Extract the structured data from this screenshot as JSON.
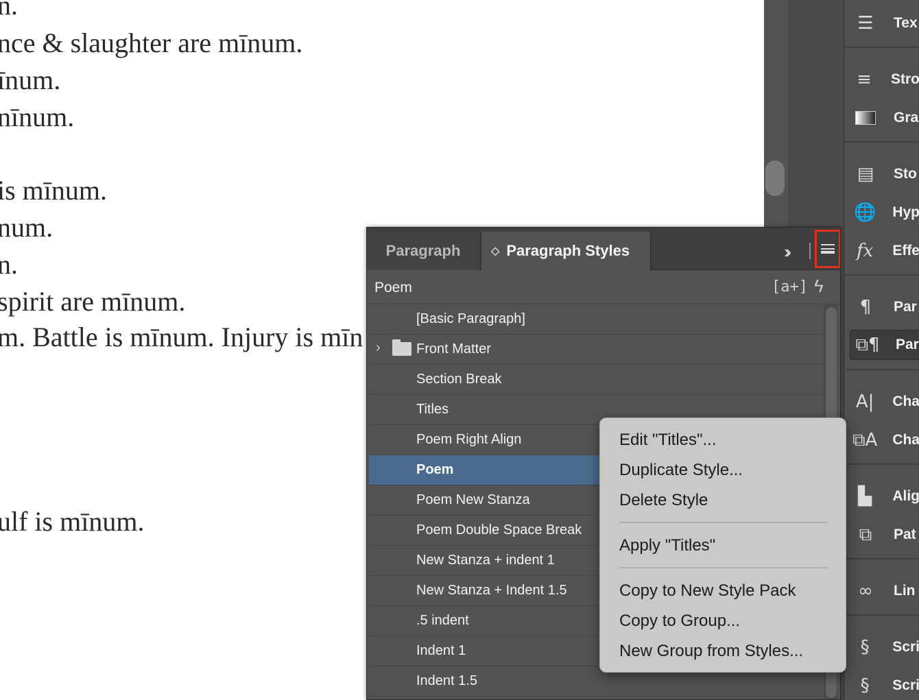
{
  "document": {
    "lines": [
      "n.",
      "nce & slaughter are mīnum.",
      "īnum.",
      "nīnum.",
      " is mīnum.",
      "num.",
      "n.",
      "spirit are mīnum.",
      "m. Battle is mīnum. Injury is mīn",
      "ulf is mīnum."
    ]
  },
  "dock": {
    "items": [
      {
        "icon": "text-wrap-icon",
        "label": "Tex"
      },
      {
        "icon": "stroke-icon",
        "label": "Stro"
      },
      {
        "icon": "gradient-icon",
        "label": "Gra"
      },
      {
        "icon": "story-icon",
        "label": "Sto"
      },
      {
        "icon": "hyperlinks-icon",
        "label": "Hyp"
      },
      {
        "icon": "effects-icon",
        "label": "Effe"
      },
      {
        "icon": "paragraph-icon",
        "label": "Par"
      },
      {
        "icon": "paragraph-styles-icon",
        "label": "Par"
      },
      {
        "icon": "character-icon",
        "label": "Cha"
      },
      {
        "icon": "character-styles-icon",
        "label": "Cha"
      },
      {
        "icon": "align-icon",
        "label": "Alig"
      },
      {
        "icon": "pathfinder-icon",
        "label": "Pat"
      },
      {
        "icon": "links-icon",
        "label": "Lin"
      },
      {
        "icon": "scripts-icon",
        "label": "Scri"
      },
      {
        "icon": "script-label-icon",
        "label": "Scri"
      }
    ]
  },
  "panel": {
    "tabs": [
      {
        "label": "Paragraph"
      },
      {
        "label": "Paragraph Styles"
      }
    ],
    "current_style": "Poem",
    "override_icon_text": "[a+]",
    "styles": [
      {
        "label": "[Basic Paragraph]"
      },
      {
        "label": "Front Matter",
        "type": "group"
      },
      {
        "label": "Section Break"
      },
      {
        "label": "Titles"
      },
      {
        "label": "Poem Right Align"
      },
      {
        "label": "Poem",
        "selected": true
      },
      {
        "label": "Poem New Stanza"
      },
      {
        "label": "Poem Double Space Break"
      },
      {
        "label": "New Stanza + indent 1"
      },
      {
        "label": "New Stanza + Indent 1.5"
      },
      {
        "label": ".5 indent"
      },
      {
        "label": "Indent 1"
      },
      {
        "label": "Indent 1.5"
      }
    ]
  },
  "context_menu": {
    "items": [
      "Edit \"Titles\"...",
      "Duplicate Style...",
      "Delete Style",
      "Apply \"Titles\"",
      "Copy to New Style Pack",
      "Copy to Group...",
      "New Group from Styles..."
    ]
  },
  "colors": {
    "selection": "#4b6a8d",
    "highlight_box": "#e0301e",
    "panel_bg": "#535353"
  }
}
